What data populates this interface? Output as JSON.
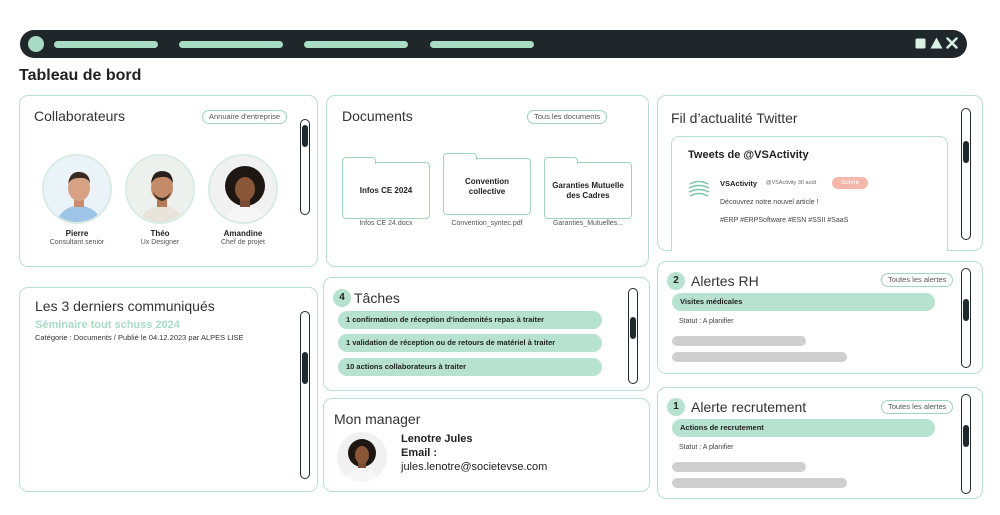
{
  "page_title": "Tableau de bord",
  "colors": {
    "accent": "#b6e2cf",
    "border": "#b9e0cf",
    "dark": "#20272b",
    "highlight": "#a8dcc4",
    "follow": "#f5b7aa"
  },
  "collaborateurs": {
    "title": "Collaborateurs",
    "button": "Annuaire d'entreprise",
    "people": [
      {
        "name": "Pierre",
        "role": "Consultant senior",
        "icon": "man-avatar-icon"
      },
      {
        "name": "Théo",
        "role": "Ux Designer",
        "icon": "man-avatar-icon"
      },
      {
        "name": "Amandine",
        "role": "Chef de projet",
        "icon": "woman-avatar-icon"
      }
    ]
  },
  "documents": {
    "title": "Documents",
    "button": "Tous les documents",
    "folders": [
      {
        "label": "Infos CE 2024",
        "file": "Infos CE 24.docx"
      },
      {
        "label": "Convention collective",
        "file": "Convention_syntec.pdf"
      },
      {
        "label": "Garanties Mutuelle des Cadres",
        "file": "Garanties_Mutuelles..."
      }
    ]
  },
  "twitter": {
    "title": "Fil d’actualité Twitter",
    "header": "Tweets de @VSActivity",
    "account": "VSActivity",
    "handle": "@VSActivity 30 août",
    "follow": "Suivre",
    "text": "Découvrez notre nouvel article !",
    "tags": "#ERP #ERPSoftware #ESN #SSII #SaaS"
  },
  "communiques": {
    "title": "Les 3 derniers communiqués",
    "headline": "Séminaire tout schuss 2024",
    "meta": "Catégorie : Documents / Publié le 04.12.2023 par ALPES LISE"
  },
  "taches": {
    "count": "4",
    "title": "Tâches",
    "items": [
      "1 confirmation de réception d'indemnités repas à traiter",
      "1 validation de réception ou de retours de matériel à traiter",
      "10 actions collaborateurs à traiter"
    ]
  },
  "manager": {
    "title": "Mon manager",
    "name": "Lenotre Jules",
    "email_label": "Email :",
    "email": "jules.lenotre@societevse.com"
  },
  "alertes_rh": {
    "count": "2",
    "title": "Alertes RH",
    "button": "Toutes les alertes",
    "item": "Visites médicales",
    "status": "Statut : A planifier"
  },
  "alerte_recrutement": {
    "count": "1",
    "title": "Alerte recrutement",
    "button": "Toutes les alertes",
    "item": "Actions de recrutement",
    "status": "Statut : A planifier"
  }
}
